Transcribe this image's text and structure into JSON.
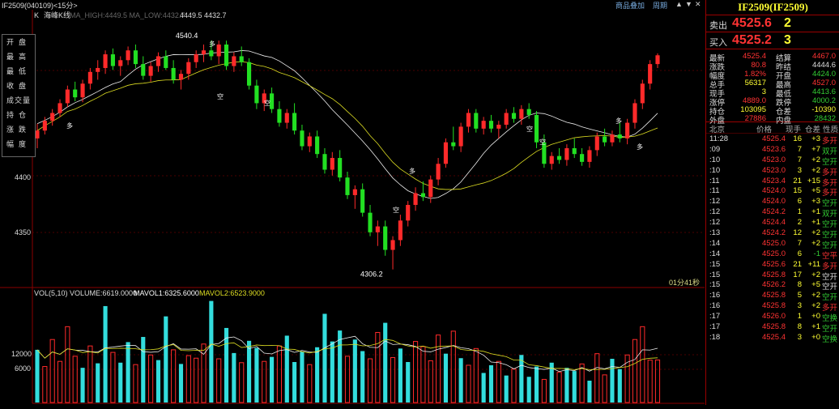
{
  "window": {
    "title": "IF2509(040109)<15分>",
    "menu_add_product": "商品叠加",
    "menu_period": "周期",
    "btn_up": "▲",
    "btn_down": "▼",
    "btn_close": "✕",
    "btn_restore": "□"
  },
  "left_menu": [
    "开盘",
    "最高",
    "最低",
    "收盘",
    "成交量",
    "持仓",
    "涨跌",
    "幅度"
  ],
  "kline_panel": {
    "label_k": "K",
    "label_name": "海峰K线",
    "ma_text": "MA_HIGH:4449.5 MA_LOW:4432.7",
    "ma_values": "4449.5  4432.7",
    "price_ticks": [
      "4400",
      "4350"
    ],
    "high_marker": "4540.4",
    "low_marker": "4306.2",
    "countdown": "01分41秒",
    "signal_long": "多",
    "signal_short": "空"
  },
  "volume_panel": {
    "header": "VOL(5,10) VOLUME:6619.0000",
    "mavol1": "MAVOL1:6325.6000",
    "mavol2": "MAVOL2:6523.9000",
    "ticks": [
      "12000",
      "6000"
    ]
  },
  "quote": {
    "title": "IF2509(IF2509)",
    "sell_label": "卖出",
    "sell_price": "4525.6",
    "sell_vol": "2",
    "buy_label": "买入",
    "buy_price": "4525.2",
    "buy_vol": "3",
    "stats": [
      {
        "l1": "最新",
        "v1": "4525.4",
        "c1": "#f33",
        "l2": "结算",
        "v2": "4467.0",
        "c2": "#f33"
      },
      {
        "l1": "涨跌",
        "v1": "80.8",
        "c1": "#f33",
        "l2": "昨结",
        "v2": "4444.6",
        "c2": "#ddd"
      },
      {
        "l1": "幅度",
        "v1": "1.82%",
        "c1": "#f33",
        "l2": "开盘",
        "v2": "4424.0",
        "c2": "#3c3"
      },
      {
        "l1": "总手",
        "v1": "56317",
        "c1": "#ff3",
        "l2": "最高",
        "v2": "4527.0",
        "c2": "#f33"
      },
      {
        "l1": "现手",
        "v1": "3",
        "c1": "#ff3",
        "l2": "最低",
        "v2": "4413.6",
        "c2": "#3c3"
      },
      {
        "l1": "涨停",
        "v1": "4889.0",
        "c1": "#f33",
        "l2": "跌停",
        "v2": "4000.2",
        "c2": "#3c3"
      },
      {
        "l1": "持仓",
        "v1": "103095",
        "c1": "#ff3",
        "l2": "仓差",
        "v2": "-10390",
        "c2": "#ff3"
      },
      {
        "l1": "外盘",
        "v1": "27886",
        "c1": "#f33",
        "l2": "内盘",
        "v2": "28432",
        "c2": "#3c3"
      }
    ],
    "trade_header": {
      "time": "北京",
      "price": "价格",
      "vol": "现手",
      "oi": "仓差",
      "nature": "性质"
    },
    "trades": [
      {
        "t": "11:28",
        "p": "4525.4",
        "v": "16",
        "o": "+3",
        "n": "多开",
        "pc": "#f33",
        "nc": "#f33"
      },
      {
        "t": ":09",
        "p": "4523.6",
        "v": "7",
        "o": "+7",
        "n": "双开",
        "pc": "#f33",
        "nc": "#3c3"
      },
      {
        "t": ":10",
        "p": "4523.0",
        "v": "7",
        "o": "+2",
        "n": "空开",
        "pc": "#f33",
        "nc": "#3c3"
      },
      {
        "t": ":10",
        "p": "4523.0",
        "v": "3",
        "o": "+2",
        "n": "多开",
        "pc": "#f33",
        "nc": "#f33"
      },
      {
        "t": ":11",
        "p": "4523.4",
        "v": "21",
        "o": "+15",
        "n": "多开",
        "pc": "#f33",
        "nc": "#f33"
      },
      {
        "t": ":11",
        "p": "4524.0",
        "v": "15",
        "o": "+5",
        "n": "多开",
        "pc": "#f33",
        "nc": "#f33"
      },
      {
        "t": ":12",
        "p": "4524.0",
        "v": "6",
        "o": "+3",
        "n": "空开",
        "pc": "#f33",
        "nc": "#3c3"
      },
      {
        "t": ":12",
        "p": "4524.2",
        "v": "1",
        "o": "+1",
        "n": "双开",
        "pc": "#f33",
        "nc": "#3c3"
      },
      {
        "t": ":12",
        "p": "4524.4",
        "v": "2",
        "o": "+1",
        "n": "空开",
        "pc": "#f33",
        "nc": "#3c3"
      },
      {
        "t": ":13",
        "p": "4524.2",
        "v": "12",
        "o": "+2",
        "n": "空开",
        "pc": "#f33",
        "nc": "#3c3"
      },
      {
        "t": ":14",
        "p": "4525.0",
        "v": "7",
        "o": "+2",
        "n": "空开",
        "pc": "#f33",
        "nc": "#3c3"
      },
      {
        "t": ":14",
        "p": "4525.0",
        "v": "6",
        "o": "-1",
        "n": "空平",
        "pc": "#f33",
        "nc": "#f33"
      },
      {
        "t": ":15",
        "p": "4525.6",
        "v": "21",
        "o": "+11",
        "n": "多开",
        "pc": "#f33",
        "nc": "#f33"
      },
      {
        "t": ":15",
        "p": "4525.8",
        "v": "17",
        "o": "+2",
        "n": "空开",
        "pc": "#f33",
        "nc": "#ddd"
      },
      {
        "t": ":15",
        "p": "4526.2",
        "v": "8",
        "o": "+5",
        "n": "空开",
        "pc": "#f33",
        "nc": "#ddd"
      },
      {
        "t": ":16",
        "p": "4525.8",
        "v": "5",
        "o": "+2",
        "n": "空开",
        "pc": "#f33",
        "nc": "#3c3"
      },
      {
        "t": ":16",
        "p": "4525.8",
        "v": "3",
        "o": "+2",
        "n": "多开",
        "pc": "#f33",
        "nc": "#f33"
      },
      {
        "t": ":17",
        "p": "4526.0",
        "v": "1",
        "o": "+0",
        "n": "空换",
        "pc": "#f33",
        "nc": "#3c3"
      },
      {
        "t": ":17",
        "p": "4525.8",
        "v": "8",
        "o": "+1",
        "n": "空开",
        "pc": "#f33",
        "nc": "#3c3"
      },
      {
        "t": ":18",
        "p": "4525.4",
        "v": "3",
        "o": "+0",
        "n": "空换",
        "pc": "#f33",
        "nc": "#3c3"
      }
    ]
  },
  "colors": {
    "up": "#ff2a2a",
    "down": "#22e022",
    "vol_up": "#ff2a2a",
    "vol_down": "#33dddd",
    "ma1": "#eeeeee",
    "ma2": "#dddd22"
  },
  "chart_data": {
    "type": "candlestick",
    "price_range": [
      4290,
      4560
    ],
    "volume_range": [
      0,
      16000
    ],
    "candles": [
      [
        4440,
        4455,
        4430,
        4448
      ],
      [
        4448,
        4462,
        4444,
        4458
      ],
      [
        4458,
        4470,
        4453,
        4466
      ],
      [
        4466,
        4480,
        4462,
        4476
      ],
      [
        4476,
        4494,
        4472,
        4490
      ],
      [
        4490,
        4498,
        4478,
        4482
      ],
      [
        4482,
        4500,
        4477,
        4496
      ],
      [
        4496,
        4512,
        4490,
        4508
      ],
      [
        4508,
        4520,
        4500,
        4512
      ],
      [
        4512,
        4530,
        4506,
        4526
      ],
      [
        4526,
        4532,
        4510,
        4514
      ],
      [
        4514,
        4524,
        4504,
        4520
      ],
      [
        4520,
        4534,
        4515,
        4530
      ],
      [
        4530,
        4536,
        4512,
        4516
      ],
      [
        4516,
        4524,
        4500,
        4504
      ],
      [
        4504,
        4518,
        4498,
        4514
      ],
      [
        4514,
        4528,
        4508,
        4524
      ],
      [
        4524,
        4530,
        4510,
        4512
      ],
      [
        4512,
        4520,
        4496,
        4500
      ],
      [
        4500,
        4510,
        4490,
        4506
      ],
      [
        4506,
        4522,
        4500,
        4518
      ],
      [
        4518,
        4530,
        4512,
        4526
      ],
      [
        4526,
        4536,
        4518,
        4530
      ],
      [
        4530,
        4540,
        4520,
        4524
      ],
      [
        4524,
        4540,
        4516,
        4536
      ],
      [
        4536,
        4540,
        4510,
        4514
      ],
      [
        4514,
        4528,
        4508,
        4524
      ],
      [
        4524,
        4534,
        4514,
        4518
      ],
      [
        4518,
        4522,
        4490,
        4494
      ],
      [
        4494,
        4500,
        4470,
        4476
      ],
      [
        4476,
        4490,
        4468,
        4486
      ],
      [
        4486,
        4492,
        4466,
        4470
      ],
      [
        4470,
        4478,
        4452,
        4456
      ],
      [
        4456,
        4470,
        4450,
        4466
      ],
      [
        4466,
        4476,
        4444,
        4448
      ],
      [
        4448,
        4454,
        4428,
        4432
      ],
      [
        4432,
        4446,
        4426,
        4442
      ],
      [
        4442,
        4448,
        4420,
        4424
      ],
      [
        4424,
        4430,
        4404,
        4408
      ],
      [
        4408,
        4426,
        4402,
        4420
      ],
      [
        4420,
        4428,
        4396,
        4400
      ],
      [
        4400,
        4406,
        4378,
        4382
      ],
      [
        4382,
        4392,
        4368,
        4388
      ],
      [
        4388,
        4394,
        4360,
        4364
      ],
      [
        4364,
        4372,
        4340,
        4344
      ],
      [
        4344,
        4356,
        4330,
        4350
      ],
      [
        4350,
        4356,
        4320,
        4326
      ],
      [
        4326,
        4340,
        4306,
        4336
      ],
      [
        4336,
        4362,
        4330,
        4356
      ],
      [
        4356,
        4376,
        4350,
        4372
      ],
      [
        4372,
        4390,
        4366,
        4384
      ],
      [
        4384,
        4396,
        4376,
        4380
      ],
      [
        4380,
        4402,
        4374,
        4398
      ],
      [
        4398,
        4420,
        4392,
        4414
      ],
      [
        4414,
        4440,
        4410,
        4436
      ],
      [
        4436,
        4452,
        4428,
        4432
      ],
      [
        4432,
        4456,
        4426,
        4452
      ],
      [
        4452,
        4470,
        4446,
        4466
      ],
      [
        4466,
        4470,
        4446,
        4450
      ],
      [
        4450,
        4462,
        4444,
        4458
      ],
      [
        4458,
        4464,
        4446,
        4450
      ],
      [
        4450,
        4458,
        4440,
        4454
      ],
      [
        4454,
        4470,
        4450,
        4466
      ],
      [
        4466,
        4472,
        4456,
        4460
      ],
      [
        4460,
        4474,
        4454,
        4470
      ],
      [
        4470,
        4476,
        4460,
        4464
      ],
      [
        4464,
        4468,
        4430,
        4436
      ],
      [
        4436,
        4444,
        4410,
        4414
      ],
      [
        4414,
        4426,
        4408,
        4422
      ],
      [
        4422,
        4430,
        4414,
        4418
      ],
      [
        4418,
        4434,
        4412,
        4430
      ],
      [
        4430,
        4440,
        4420,
        4424
      ],
      [
        4424,
        4430,
        4412,
        4416
      ],
      [
        4416,
        4432,
        4410,
        4428
      ],
      [
        4428,
        4446,
        4422,
        4442
      ],
      [
        4442,
        4450,
        4432,
        4436
      ],
      [
        4436,
        4448,
        4432,
        4444
      ],
      [
        4444,
        4456,
        4436,
        4440
      ],
      [
        4440,
        4460,
        4434,
        4456
      ],
      [
        4456,
        4480,
        4450,
        4476
      ],
      [
        4476,
        4500,
        4470,
        4496
      ],
      [
        4496,
        4520,
        4490,
        4516
      ],
      [
        4516,
        4527,
        4512,
        4525
      ]
    ],
    "volumes": [
      {
        "v": 8200,
        "up": false
      },
      {
        "v": 5600,
        "up": true
      },
      {
        "v": 9800,
        "up": true
      },
      {
        "v": 6400,
        "up": true
      },
      {
        "v": 11800,
        "up": true
      },
      {
        "v": 7200,
        "up": true
      },
      {
        "v": 5400,
        "up": false
      },
      {
        "v": 8800,
        "up": true
      },
      {
        "v": 6100,
        "up": false
      },
      {
        "v": 15000,
        "up": false
      },
      {
        "v": 7800,
        "up": true
      },
      {
        "v": 6200,
        "up": false
      },
      {
        "v": 9400,
        "up": false
      },
      {
        "v": 5900,
        "up": true
      },
      {
        "v": 10200,
        "up": false
      },
      {
        "v": 7400,
        "up": true
      },
      {
        "v": 6600,
        "up": false
      },
      {
        "v": 13400,
        "up": false
      },
      {
        "v": 8200,
        "up": true
      },
      {
        "v": 6000,
        "up": false
      },
      {
        "v": 7300,
        "up": true
      },
      {
        "v": 6900,
        "up": true
      },
      {
        "v": 9100,
        "up": true
      },
      {
        "v": 15800,
        "up": false
      },
      {
        "v": 6800,
        "up": true
      },
      {
        "v": 11600,
        "up": false
      },
      {
        "v": 7700,
        "up": false
      },
      {
        "v": 6200,
        "up": true
      },
      {
        "v": 9600,
        "up": false
      },
      {
        "v": 8500,
        "up": false
      },
      {
        "v": 6400,
        "up": true
      },
      {
        "v": 7100,
        "up": false
      },
      {
        "v": 8800,
        "up": true
      },
      {
        "v": 10400,
        "up": false
      },
      {
        "v": 6300,
        "up": false
      },
      {
        "v": 7900,
        "up": false
      },
      {
        "v": 5900,
        "up": true
      },
      {
        "v": 8600,
        "up": false
      },
      {
        "v": 13800,
        "up": false
      },
      {
        "v": 9500,
        "up": false
      },
      {
        "v": 11200,
        "up": false
      },
      {
        "v": 7200,
        "up": true
      },
      {
        "v": 9800,
        "up": false
      },
      {
        "v": 8000,
        "up": false
      },
      {
        "v": 6800,
        "up": true
      },
      {
        "v": 10900,
        "up": true
      },
      {
        "v": 12400,
        "up": false
      },
      {
        "v": 7000,
        "up": true
      },
      {
        "v": 8400,
        "up": false
      },
      {
        "v": 6300,
        "up": false
      },
      {
        "v": 9500,
        "up": true
      },
      {
        "v": 8700,
        "up": true
      },
      {
        "v": 6500,
        "up": true
      },
      {
        "v": 10500,
        "up": true
      },
      {
        "v": 7600,
        "up": false
      },
      {
        "v": 11100,
        "up": true
      },
      {
        "v": 6900,
        "up": false
      },
      {
        "v": 5800,
        "up": true
      },
      {
        "v": 8400,
        "up": true
      },
      {
        "v": 4600,
        "up": false
      },
      {
        "v": 5800,
        "up": false
      },
      {
        "v": 6400,
        "up": true
      },
      {
        "v": 4200,
        "up": false
      },
      {
        "v": 5200,
        "up": true
      },
      {
        "v": 7400,
        "up": false
      },
      {
        "v": 4000,
        "up": false
      },
      {
        "v": 5600,
        "up": false
      },
      {
        "v": 3600,
        "up": true
      },
      {
        "v": 6200,
        "up": false
      },
      {
        "v": 4700,
        "up": true
      },
      {
        "v": 5400,
        "up": false
      },
      {
        "v": 4900,
        "up": false
      },
      {
        "v": 6000,
        "up": true
      },
      {
        "v": 3400,
        "up": false
      },
      {
        "v": 7600,
        "up": true
      },
      {
        "v": 4300,
        "up": true
      },
      {
        "v": 6800,
        "up": false
      },
      {
        "v": 5200,
        "up": false
      },
      {
        "v": 7400,
        "up": true
      },
      {
        "v": 9800,
        "up": true
      },
      {
        "v": 11800,
        "up": true
      },
      {
        "v": 6600,
        "up": true
      },
      {
        "v": 6619,
        "up": true
      }
    ]
  }
}
